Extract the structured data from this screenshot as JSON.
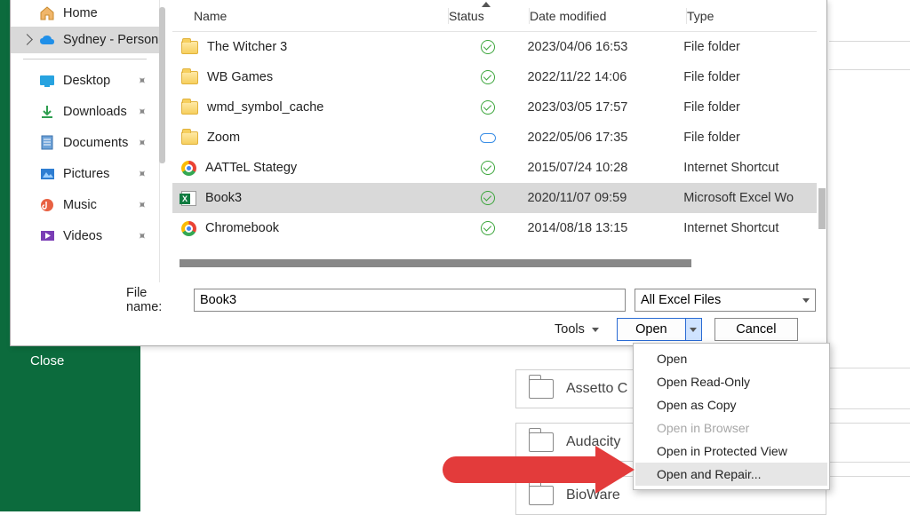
{
  "sidebar": {
    "home": "Home",
    "personal": "Sydney - Person",
    "items": [
      {
        "label": "Desktop"
      },
      {
        "label": "Downloads"
      },
      {
        "label": "Documents"
      },
      {
        "label": "Pictures"
      },
      {
        "label": "Music"
      },
      {
        "label": "Videos"
      }
    ]
  },
  "columns": {
    "name": "Name",
    "status": "Status",
    "date": "Date modified",
    "type": "Type"
  },
  "rows": [
    {
      "name": "The Witcher 3",
      "icon": "folder",
      "status": "ok",
      "date": "2023/04/06 16:53",
      "type": "File folder"
    },
    {
      "name": "WB Games",
      "icon": "folder",
      "status": "ok",
      "date": "2022/11/22 14:06",
      "type": "File folder"
    },
    {
      "name": "wmd_symbol_cache",
      "icon": "folder",
      "status": "ok",
      "date": "2023/03/05 17:57",
      "type": "File folder"
    },
    {
      "name": "Zoom",
      "icon": "folder",
      "status": "cloud",
      "date": "2022/05/06 17:35",
      "type": "File folder"
    },
    {
      "name": "AATTeL Stategy",
      "icon": "chrome",
      "status": "ok",
      "date": "2015/07/24 10:28",
      "type": "Internet Shortcut"
    },
    {
      "name": "Book3",
      "icon": "excel",
      "status": "ok",
      "date": "2020/11/07 09:59",
      "type": "Microsoft Excel Wo",
      "selected": true
    },
    {
      "name": "Chromebook",
      "icon": "chrome",
      "status": "ok",
      "date": "2014/08/18 13:15",
      "type": "Internet Shortcut"
    }
  ],
  "filename": {
    "label": "File name:",
    "value": "Book3"
  },
  "filetype": {
    "selected": "All Excel Files"
  },
  "tools": "Tools",
  "buttons": {
    "open": "Open",
    "cancel": "Cancel"
  },
  "menu": [
    {
      "label": "Open"
    },
    {
      "label": "Open Read-Only"
    },
    {
      "label": "Open as Copy"
    },
    {
      "label": "Open in Browser",
      "disabled": true
    },
    {
      "label": "Open in Protected View"
    },
    {
      "label": "Open and Repair...",
      "highlight": true
    }
  ],
  "close": "Close",
  "bg_tiles": [
    "Assetto C",
    "Audacity",
    "BioWare"
  ]
}
